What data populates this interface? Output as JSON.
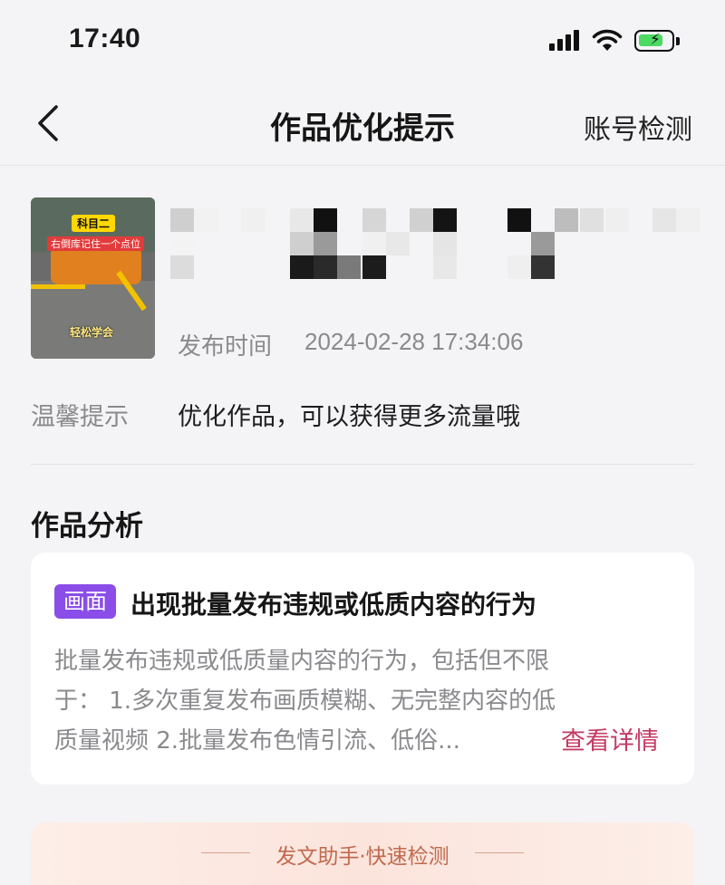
{
  "status_bar": {
    "time": "17:40",
    "icons": [
      "signal-icon",
      "wifi-icon",
      "battery-charging-icon"
    ]
  },
  "nav": {
    "back_icon": "chevron-left-icon",
    "title": "作品优化提示",
    "right_action": "账号检测"
  },
  "video": {
    "thumbnail": {
      "badge": "科目二",
      "caption": "右倒库记住一个点位",
      "watermark": "轻松学会"
    },
    "publish_label": "发布时间",
    "publish_time": "2024-02-28 17:34:06"
  },
  "tip": {
    "label": "温馨提示",
    "text": "优化作品，可以获得更多流量哦"
  },
  "analysis": {
    "section_title": "作品分析",
    "card": {
      "tag": "画面",
      "title": "出现批量发布违规或低质内容的行为",
      "description_lines": [
        "批量发布违规或低质量内容的行为，包括但不限",
        "于：   1.多次重复发布画质模糊、无完整内容的低",
        "质量视频   2.批量发布色情引流、低俗..."
      ],
      "detail_link": "查看详情"
    }
  },
  "helper": {
    "title": "发文助手·快速检测"
  },
  "colors": {
    "tag_purple": "#8a4de8",
    "link_red": "#c43963",
    "muted_gray": "#8a8a8e",
    "battery_green": "#4cd964"
  }
}
